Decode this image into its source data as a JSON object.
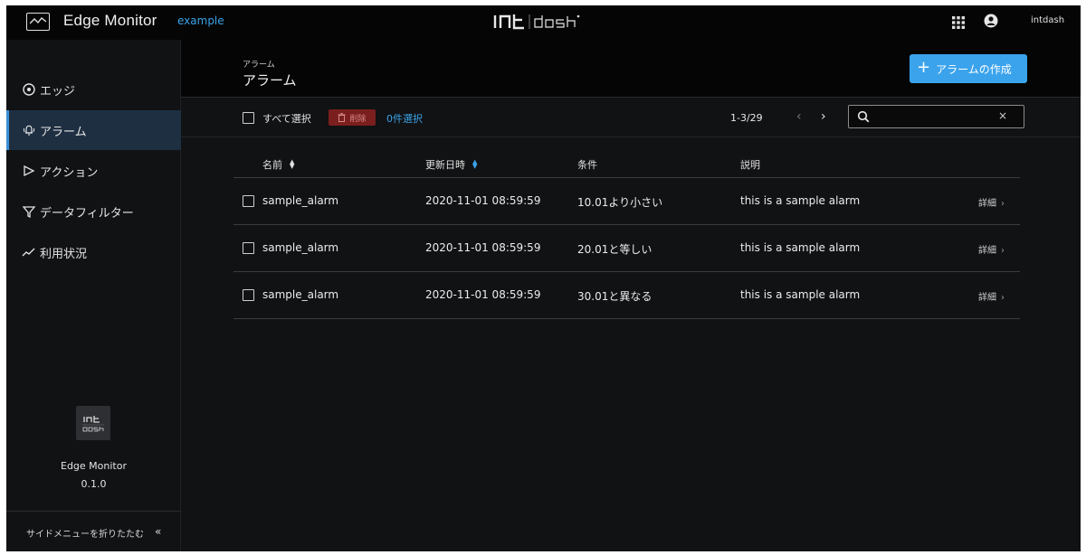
{
  "header": {
    "app_title": "Edge Monitor",
    "project": "example",
    "brand": "intdash",
    "user": "intdash"
  },
  "sidebar": {
    "items": [
      {
        "label": "エッジ",
        "icon": "target-icon",
        "active": false
      },
      {
        "label": "アラーム",
        "icon": "bell-icon",
        "active": true
      },
      {
        "label": "アクション",
        "icon": "play-icon",
        "active": false
      },
      {
        "label": "データフィルター",
        "icon": "filter-icon",
        "active": false
      },
      {
        "label": "利用状況",
        "icon": "trend-icon",
        "active": false
      }
    ],
    "version_name": "Edge Monitor",
    "version": "0.1.0",
    "collapse_label": "サイドメニューを折りたたむ",
    "collapse_icon": "«"
  },
  "page": {
    "breadcrumb": "アラーム",
    "title": "アラーム",
    "create_button": "アラームの作成"
  },
  "toolbar": {
    "select_all": "すべて選択",
    "delete": "削除",
    "selected": "0件選択",
    "pagination": "1-3/29",
    "search_placeholder": "",
    "clear": "×"
  },
  "table": {
    "columns": {
      "name": "名前",
      "updated": "更新日時",
      "condition": "条件",
      "description": "説明"
    },
    "rows": [
      {
        "name": "sample_alarm",
        "updated": "2020-11-01 08:59:59",
        "condition": "10.01より小さい",
        "description": "this is a sample alarm",
        "detail": "詳細"
      },
      {
        "name": "sample_alarm",
        "updated": "2020-11-01 08:59:59",
        "condition": "20.01と等しい",
        "description": "this is a sample alarm",
        "detail": "詳細"
      },
      {
        "name": "sample_alarm",
        "updated": "2020-11-01 08:59:59",
        "condition": "30.01と異なる",
        "description": "this is a sample alarm",
        "detail": "詳細"
      }
    ]
  },
  "colors": {
    "accent": "#3ba3ec",
    "danger": "#7a1e1e",
    "active_nav": "#1e2f42"
  }
}
